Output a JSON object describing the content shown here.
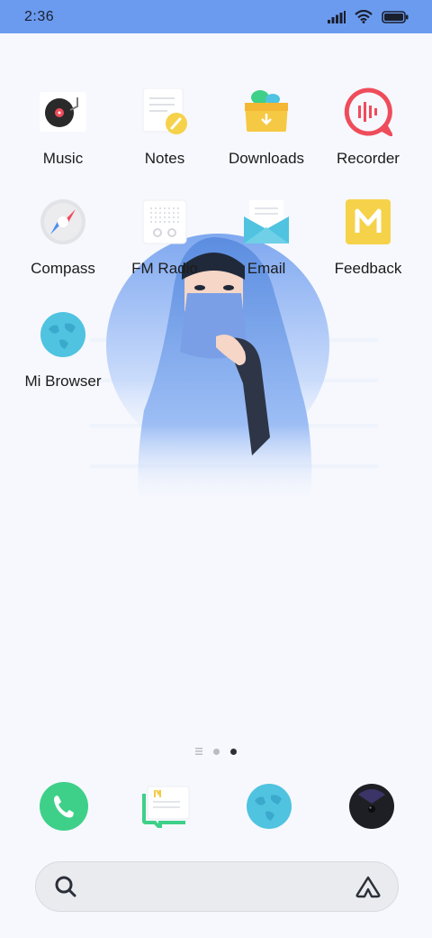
{
  "status_bar": {
    "time": "2:36",
    "icons": [
      "signal-icon",
      "wifi-icon",
      "battery-icon"
    ]
  },
  "apps": [
    {
      "label": "Music",
      "icon": "music-icon"
    },
    {
      "label": "Notes",
      "icon": "notes-icon"
    },
    {
      "label": "Downloads",
      "icon": "downloads-icon"
    },
    {
      "label": "Recorder",
      "icon": "recorder-icon"
    },
    {
      "label": "Compass",
      "icon": "compass-icon"
    },
    {
      "label": "FM Radio",
      "icon": "radio-icon"
    },
    {
      "label": "Email",
      "icon": "email-icon"
    },
    {
      "label": "Feedback",
      "icon": "feedback-icon"
    },
    {
      "label": "Mi Browser",
      "icon": "browser-icon"
    }
  ],
  "page_indicator": {
    "count": 2,
    "active": 2,
    "has_list_marker": true
  },
  "dock": [
    "phone-icon",
    "messages-icon",
    "browser-icon",
    "camera-icon"
  ],
  "search_bar": {
    "left_icon": "search-icon",
    "right_icon": "assistant-icon"
  },
  "colors": {
    "status_bar": "#6b9bef",
    "background": "#f6f8fd",
    "accent_blue": "#4fc3e0",
    "accent_green": "#3ed089",
    "accent_yellow": "#f6d24a",
    "accent_red": "#ef4c5b"
  }
}
